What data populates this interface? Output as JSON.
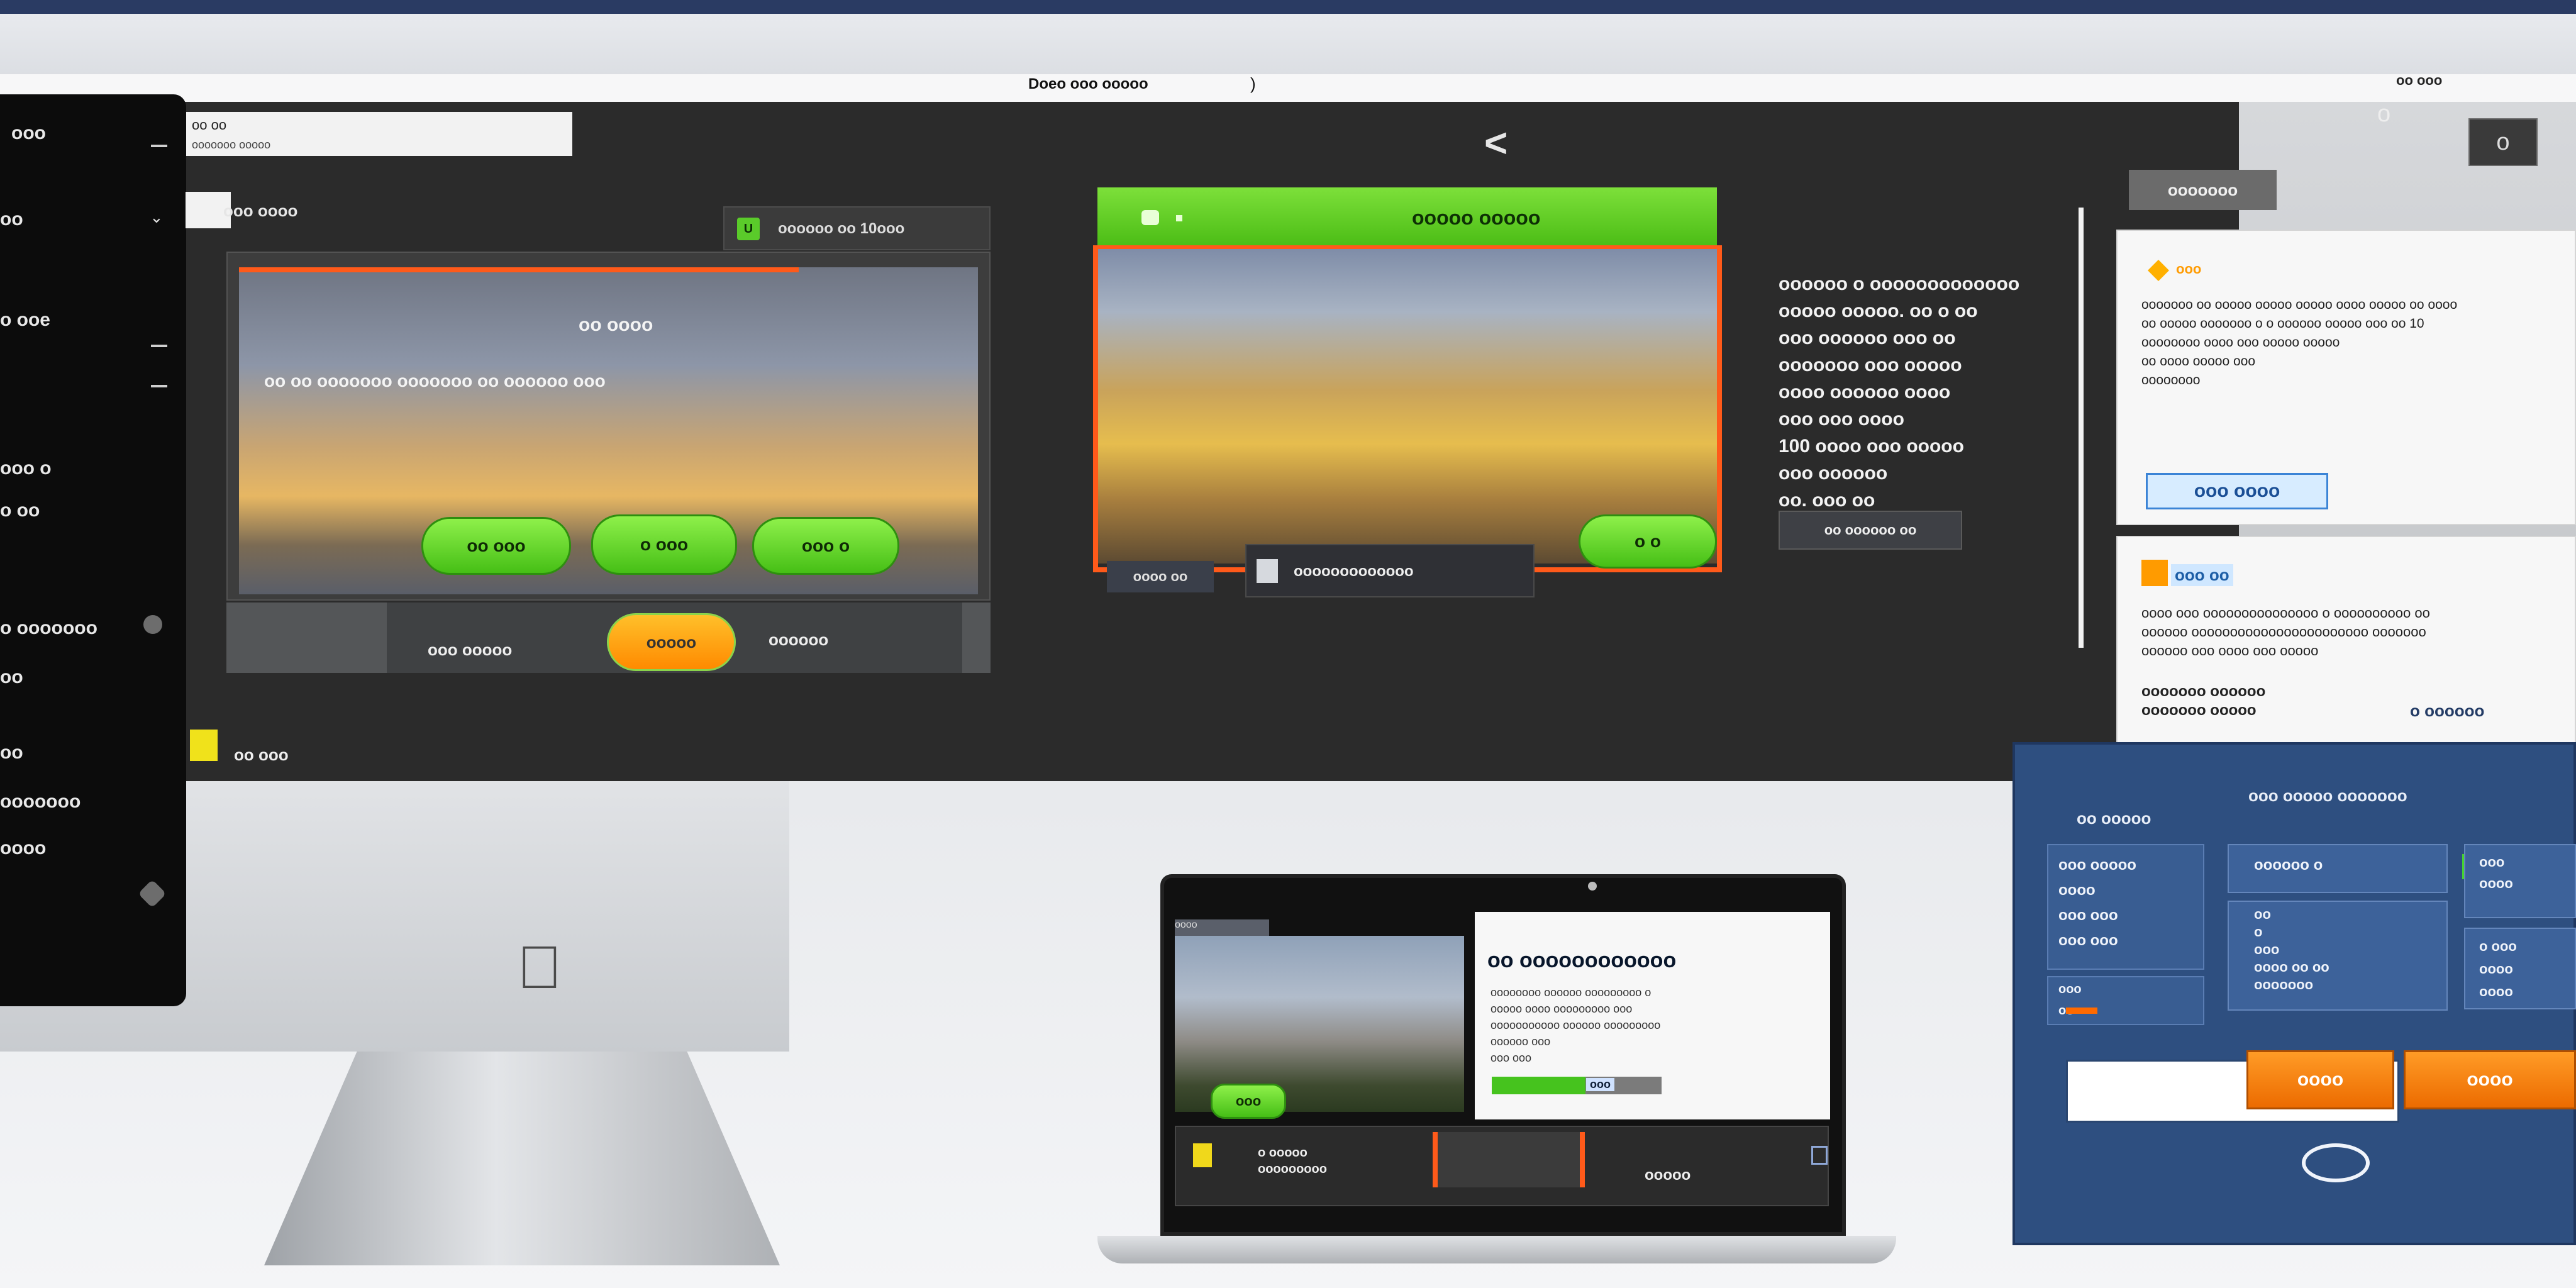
{
  "top": {
    "url_text": "Doeo ooo ooooo",
    "url_caret": ")",
    "right_text": "oo ooo",
    "circle_icon_char": "o",
    "tab_label": "oo oo",
    "tab_sub": "ooooooo ooooo",
    "back_symbol": "<",
    "top_right_button": "o"
  },
  "sidebar": {
    "items": [
      {
        "label": "ooo"
      },
      {
        "label": "oo"
      },
      {
        "label": "o ooe"
      },
      {
        "label": "ooo o"
      },
      {
        "label": "o oo"
      },
      {
        "label": "o ooooooo"
      },
      {
        "label": "oo"
      },
      {
        "label": "oo"
      },
      {
        "label": "ooooooo"
      },
      {
        "label": "oooo"
      }
    ]
  },
  "main": {
    "section_title": "ooo oooo",
    "left_card": {
      "header": "oooooo oo 10ooo",
      "header_badge": "U",
      "title": "oo oooo",
      "subtitle": "oo oo ooooooo ooooooo oo oooooo ooo",
      "buttons": [
        "oo ooo",
        "o ooo",
        "ooo o"
      ],
      "footer_left": "ooo ooooo",
      "footer_pill": "ooooo",
      "footer_right": "oooooo"
    },
    "bottom_label": "oo ooo",
    "center_card": {
      "header": "ooooo ooooo",
      "green_button": "o o",
      "bar_left": "oooo oo",
      "bar_mid": "ooooooooooooo"
    },
    "right_text": {
      "lines": [
        "oooooo o ooooooooooooo",
        "ooooo ooooo. oo o oo",
        "ooo oooooo ooo oo",
        "ooooooo ooo ooooo",
        "oooo oooooo oooo",
        "ooo ooo oooo",
        "100 oooo ooo ooooo",
        "ooo oooooo",
        "oo. ooo oo"
      ],
      "button": "oo oooooo oo"
    },
    "badge_dark": "ooooooo",
    "white_panel_1": {
      "title": "ooo",
      "body": [
        "ooooooo oo ooooo ooooo ooooo oooo ooooo oo oooo",
        "oo ooooo ooooooo o o oooooo ooooo ooo oo 10",
        "oooooooo oooo ooo ooooo ooooo",
        "oo oooo ooooo ooo",
        "oooooooo"
      ],
      "button": "ooo oooo"
    },
    "white_panel_2": {
      "title": "ooo oo",
      "body": [
        "oooo ooo ooooooooooooooo o oooooooooo oo",
        "oooooo ooooooooooooooooooooooo ooooooo",
        "oooooo ooo oooo ooo ooooo"
      ],
      "footer_left": "ooooooo oooooo",
      "footer_left2": "ooooooo ooooo",
      "footer_right": "o oooooo"
    },
    "blue_dialog": {
      "title": "ooo ooooo ooooooo",
      "left_heading": "oo ooooo",
      "left_items": [
        "ooo ooooo",
        "oooo",
        "ooo ooo",
        "ooo ooo"
      ],
      "left_small": [
        "ooo",
        "oo"
      ],
      "mid_items": [
        "oooooo o",
        "oo",
        "o",
        "ooo",
        "oooo oo oo",
        "ooooooo"
      ],
      "right_items": [
        "ooo",
        "oooo",
        "o ooo",
        "oooo",
        "oooo"
      ],
      "buttons": [
        "oooo",
        "oooo"
      ]
    },
    "laptop": {
      "top_left": "oooo",
      "title": "oo oooooooooooo",
      "body": [
        "oooooooo oooooo ooooooooo o",
        "ooooo oooo ooooooooo ooo",
        "ooooooooooo oooooo ooooooooo",
        "oooooo ooo",
        "ooo ooo"
      ],
      "green_button": "ooo",
      "progress": 0.55,
      "progress_label": "ooo",
      "bottom_t1": "o ooooo",
      "bottom_t1b": "ooooooooo",
      "bottom_t2": "ooooo"
    }
  },
  "colors": {
    "accent_green": "#46bf16",
    "accent_orange": "#ff8a00",
    "dialog_blue": "#2e4f80"
  }
}
